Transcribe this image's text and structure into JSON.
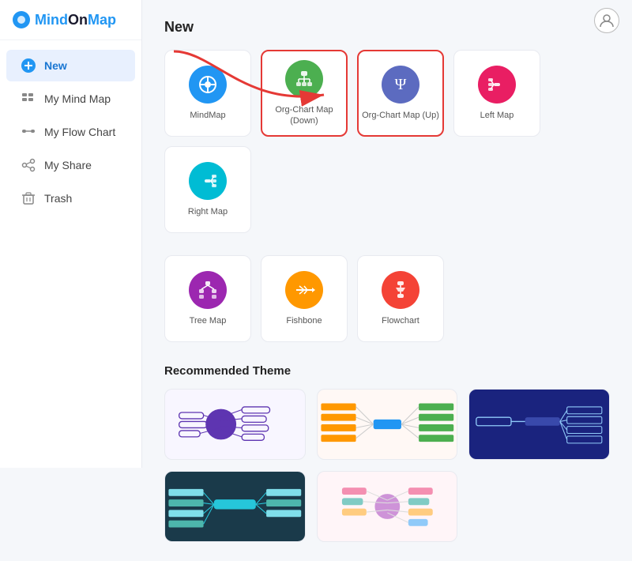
{
  "logo": {
    "text_mind": "Mind",
    "text_on": "On",
    "text_map": "Map"
  },
  "sidebar": {
    "items": [
      {
        "id": "new",
        "label": "New",
        "icon": "plus",
        "active": true
      },
      {
        "id": "my-mind-map",
        "label": "My Mind Map",
        "icon": "grid"
      },
      {
        "id": "my-flow-chart",
        "label": "My Flow Chart",
        "icon": "flow"
      },
      {
        "id": "my-share",
        "label": "My Share",
        "icon": "share"
      },
      {
        "id": "trash",
        "label": "Trash",
        "icon": "trash"
      }
    ]
  },
  "main": {
    "section_title": "New",
    "templates": [
      {
        "id": "mindmap",
        "label": "MindMap",
        "color": "#2196f3",
        "icon": "⊕",
        "highlighted": false
      },
      {
        "id": "org-chart-down",
        "label": "Org-Chart Map\n(Down)",
        "color": "#4caf50",
        "icon": "⊞",
        "highlighted": true
      },
      {
        "id": "org-chart-up",
        "label": "Org-Chart Map (Up)",
        "color": "#5c6bc0",
        "icon": "Ψ",
        "highlighted": true
      },
      {
        "id": "left-map",
        "label": "Left Map",
        "color": "#e91e63",
        "icon": "⊣",
        "highlighted": false
      },
      {
        "id": "right-map",
        "label": "Right Map",
        "color": "#00bcd4",
        "icon": "⊢",
        "highlighted": false
      },
      {
        "id": "tree-map",
        "label": "Tree Map",
        "color": "#9c27b0",
        "icon": "⊟",
        "highlighted": false
      },
      {
        "id": "fishbone",
        "label": "Fishbone",
        "color": "#ff9800",
        "icon": "✴",
        "highlighted": false
      },
      {
        "id": "flowchart",
        "label": "Flowchart",
        "color": "#f44336",
        "icon": "⊕",
        "highlighted": false
      }
    ],
    "recommended_title": "Recommended Theme",
    "themes": [
      {
        "id": "theme1",
        "style": "light-purple"
      },
      {
        "id": "theme2",
        "style": "light-colorful"
      },
      {
        "id": "theme3",
        "style": "dark-blue"
      },
      {
        "id": "theme4",
        "style": "dark-teal"
      },
      {
        "id": "theme5",
        "style": "light-pink"
      }
    ]
  }
}
